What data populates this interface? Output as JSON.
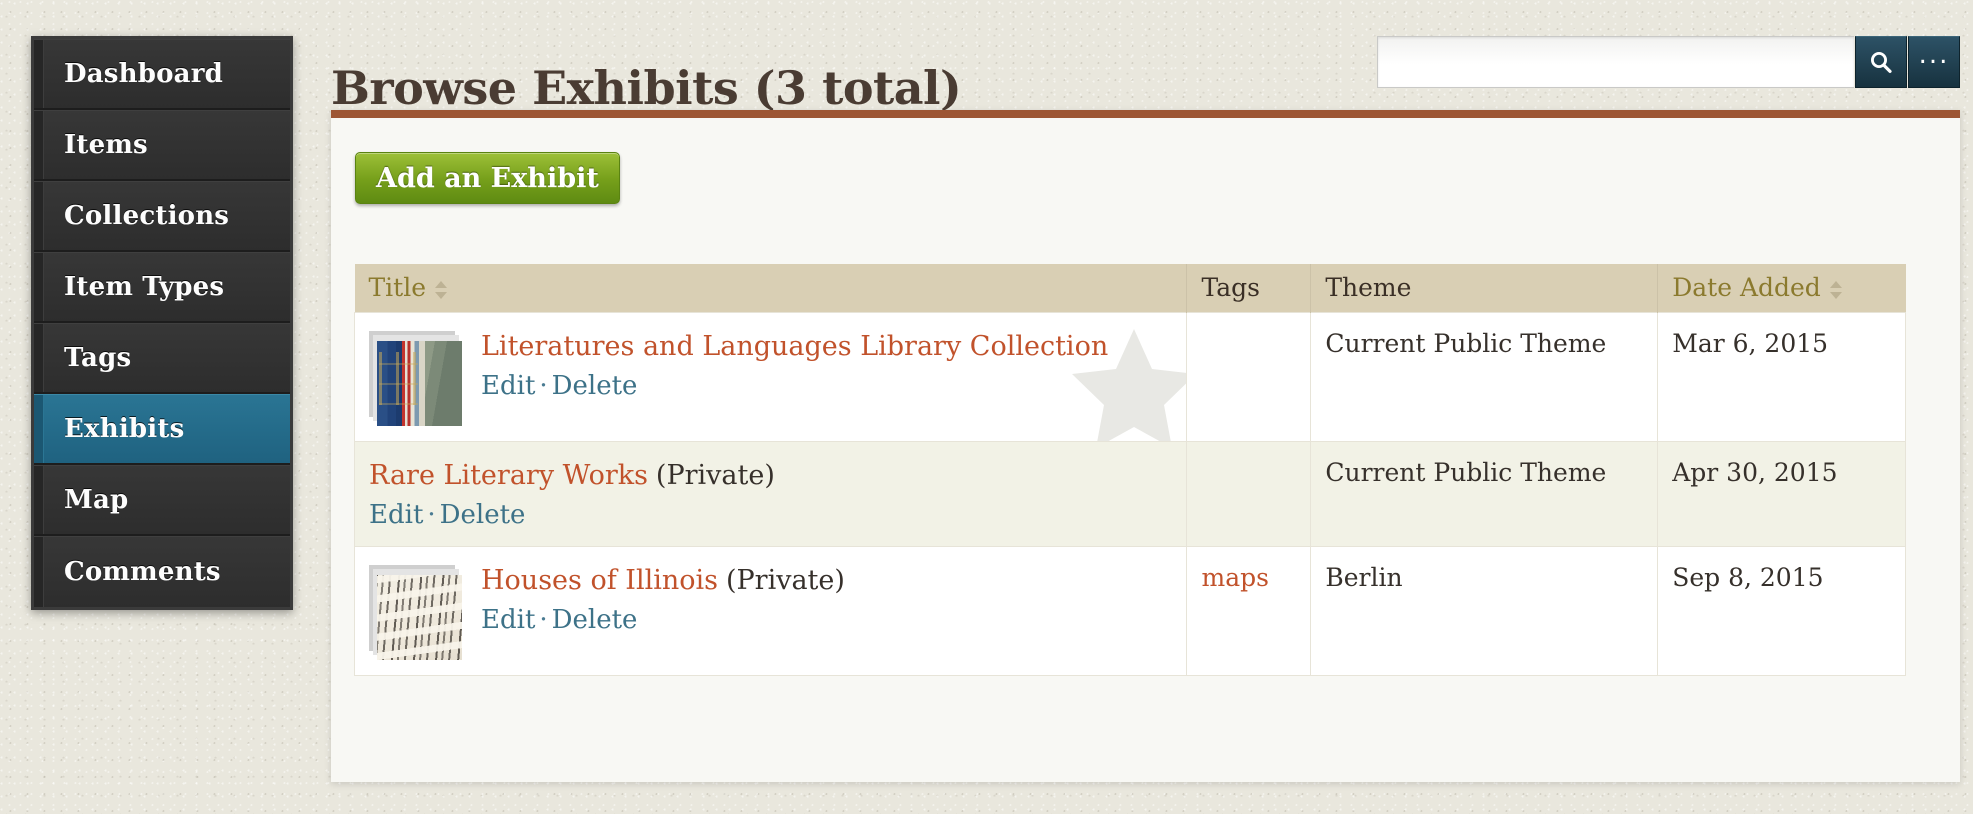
{
  "theme": {
    "accent_brown": "#9d5634",
    "link_orange": "#c1522b",
    "nav_active_blue": "#216684",
    "button_green": "#77a01b",
    "table_header_tan": "#d9cfb4",
    "page_background": "#e9e7dd"
  },
  "sidebar": {
    "items": [
      {
        "label": "Dashboard",
        "active": false
      },
      {
        "label": "Items",
        "active": false
      },
      {
        "label": "Collections",
        "active": false
      },
      {
        "label": "Item Types",
        "active": false
      },
      {
        "label": "Tags",
        "active": false
      },
      {
        "label": "Exhibits",
        "active": true
      },
      {
        "label": "Map",
        "active": false
      },
      {
        "label": "Comments",
        "active": false
      }
    ]
  },
  "header": {
    "title": "Browse Exhibits (3 total)"
  },
  "search": {
    "value": "",
    "placeholder": "",
    "search_icon": "search-icon",
    "options_icon": "ellipsis-icon",
    "options_label": "..."
  },
  "toolbar": {
    "add_exhibit_label": "Add an Exhibit"
  },
  "table": {
    "columns": [
      {
        "label": "Title",
        "sortable": true
      },
      {
        "label": "Tags",
        "sortable": false
      },
      {
        "label": "Theme",
        "sortable": false
      },
      {
        "label": "Date Added",
        "sortable": true
      }
    ],
    "rows": [
      {
        "title": "Literatures and Languages Library Collection",
        "privacy": "",
        "edit_label": "Edit",
        "separator": "·",
        "delete_label": "Delete",
        "thumbnail": "books-on-shelf-photo",
        "has_thumbnail": true,
        "featured": true,
        "tags": "",
        "theme": "Current Public Theme",
        "date_added": "Mar 6, 2015"
      },
      {
        "title": "Rare Literary Works",
        "privacy": "(Private)",
        "edit_label": "Edit",
        "separator": "·",
        "delete_label": "Delete",
        "thumbnail": "",
        "has_thumbnail": false,
        "featured": false,
        "tags": "",
        "theme": "Current Public Theme",
        "date_added": "Apr 30, 2015"
      },
      {
        "title": "Houses of Illinois",
        "privacy": "(Private)",
        "edit_label": "Edit",
        "separator": "·",
        "delete_label": "Delete",
        "thumbnail": "manuscript-page-photo",
        "has_thumbnail": true,
        "featured": false,
        "tags": "maps",
        "theme": "Berlin",
        "date_added": "Sep 8, 2015"
      }
    ]
  }
}
